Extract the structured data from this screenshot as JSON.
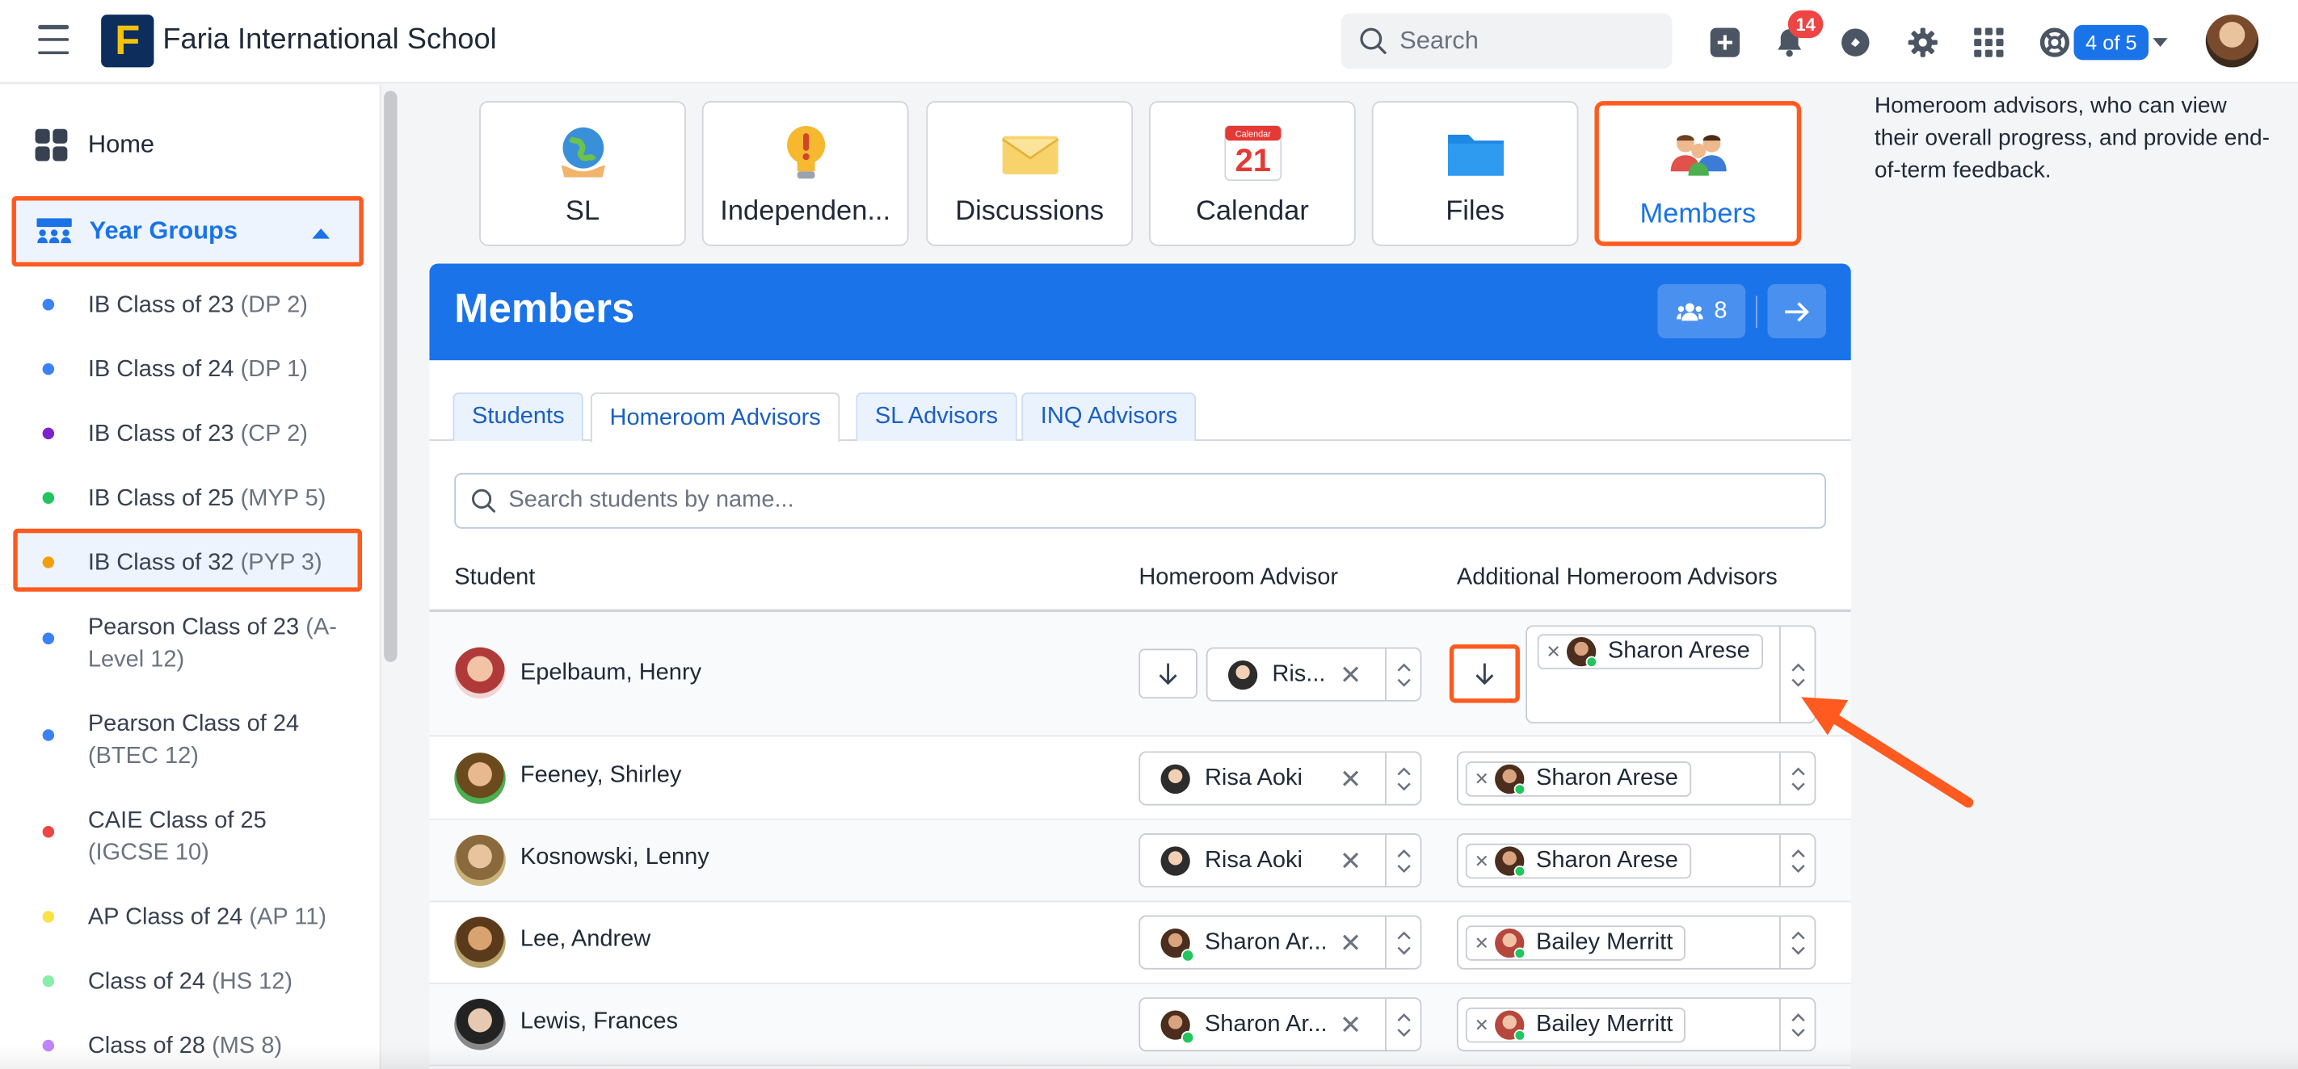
{
  "topbar": {
    "logo_letter": "F",
    "school_name": "Faria International School",
    "search_placeholder": "Search",
    "notification_count": "14",
    "pager": "4 of 5"
  },
  "sidebar": {
    "home": "Home",
    "year_groups": "Year Groups",
    "items": [
      {
        "name": "IB Class of 23",
        "tag": "(DP 2)",
        "color": "#3b82f6"
      },
      {
        "name": "IB Class of 24",
        "tag": "(DP 1)",
        "color": "#3b82f6"
      },
      {
        "name": "IB Class of 23",
        "tag": "(CP 2)",
        "color": "#7e22ce"
      },
      {
        "name": "IB Class of 25",
        "tag": "(MYP 5)",
        "color": "#22c55e"
      },
      {
        "name": "IB Class of 32",
        "tag": "(PYP 3)",
        "color": "#f59e0b"
      },
      {
        "name": "Pearson Class of 23",
        "tag": "(A-Level 12)",
        "color": "#3b82f6"
      },
      {
        "name": "Pearson Class of 24",
        "tag": "(BTEC 12)",
        "color": "#3b82f6"
      },
      {
        "name": "CAIE Class of 25",
        "tag": "(IGCSE 10)",
        "color": "#ef4444"
      },
      {
        "name": "AP Class of 24",
        "tag": "(AP 11)",
        "color": "#fde047"
      },
      {
        "name": "Class of 24",
        "tag": "(HS 12)",
        "color": "#86efac"
      },
      {
        "name": "Class of 28",
        "tag": "(MS 8)",
        "color": "#c084fc"
      }
    ]
  },
  "tools": [
    {
      "label": "SL",
      "icon": "globe-hands-icon"
    },
    {
      "label": "Independen...",
      "icon": "lightbulb-icon"
    },
    {
      "label": "Discussions",
      "icon": "envelope-icon"
    },
    {
      "label": "Calendar",
      "icon": "calendar-icon",
      "day": "21",
      "month": "Calendar"
    },
    {
      "label": "Files",
      "icon": "folder-icon"
    },
    {
      "label": "Members",
      "icon": "people-icon"
    }
  ],
  "members": {
    "title": "Members",
    "count": "8",
    "tabs": [
      "Students",
      "Homeroom Advisors",
      "SL Advisors",
      "INQ Advisors"
    ],
    "active_tab": "Homeroom Advisors",
    "search_placeholder": "Search students by name...",
    "columns": {
      "student": "Student",
      "advisor": "Homeroom Advisor",
      "additional": "Additional Homeroom Advisors"
    },
    "rows": [
      {
        "student": "Epelbaum, Henry",
        "advisor": "Ris...",
        "additional": "Sharon Arese"
      },
      {
        "student": "Feeney, Shirley",
        "advisor": "Risa Aoki",
        "additional": "Sharon Arese"
      },
      {
        "student": "Kosnowski, Lenny",
        "advisor": "Risa Aoki",
        "additional": "Sharon Arese"
      },
      {
        "student": "Lee, Andrew",
        "advisor": "Sharon Ar...",
        "additional": "Bailey Merritt"
      },
      {
        "student": "Lewis, Frances",
        "advisor": "Sharon Ar...",
        "additional": "Bailey Merritt"
      }
    ]
  },
  "help_text": "Homeroom advisors, who can view their overall progress, and provide end-of-term feedback.",
  "colors": {
    "accent": "#1a73e8",
    "highlight": "#ff5a1f"
  }
}
